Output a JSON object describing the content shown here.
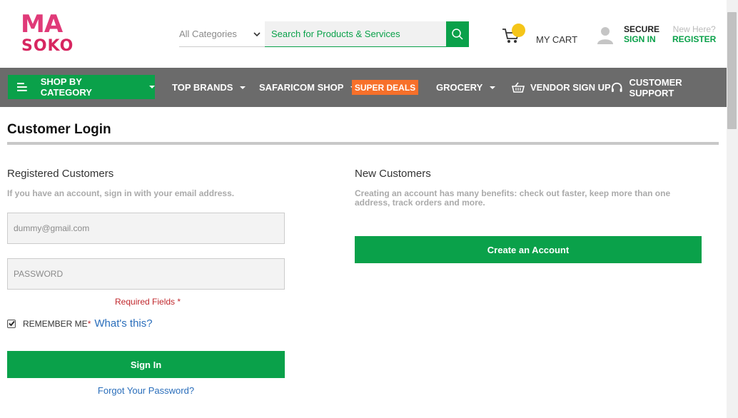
{
  "brand": {
    "logo_top": "MA",
    "logo_bottom": "SOKO"
  },
  "search": {
    "category": "All Categories",
    "placeholder": "Search for Products & Services"
  },
  "header": {
    "cart_label": "MY CART",
    "secure_label": "SECURE",
    "sign_in_label": "SIGN IN",
    "new_here_label": "New Here?",
    "register_label": "REGISTER"
  },
  "nav": {
    "shop_by_category": "SHOP BY CATEGORY",
    "top_brands": "TOP BRANDS",
    "safaricom_shop": "SAFARICOM SHOP",
    "super_deals": "SUPER DEALS",
    "grocery": "GROCERY",
    "vendor_sign_up": "VENDOR SIGN UP",
    "customer_support": "CUSTOMER SUPPORT"
  },
  "page": {
    "title": "Customer Login"
  },
  "registered": {
    "title": "Registered Customers",
    "subtitle": "If you have an account, sign in with your email address.",
    "email_placeholder": "dummy@gmail.com",
    "password_placeholder": "PASSWORD",
    "required_label": "Required Fields",
    "required_star": "*",
    "remember_label": "REMEMBER ME",
    "remember_star": "*",
    "remember_checked": true,
    "whats_this": "What's this?",
    "sign_in_button": "Sign In",
    "forgot_link": "Forgot Your Password?"
  },
  "new_customers": {
    "title": "New Customers",
    "description": "Creating an account has many benefits: check out faster, keep more than one address, track orders and more.",
    "create_button": "Create an Account"
  },
  "colors": {
    "brand_green": "#0aa14a",
    "nav_gray": "#6b6b6b",
    "deals_orange": "#f7702a",
    "link_blue": "#2a6ebb",
    "required_red": "#c0282d",
    "badge_yellow": "#f5c518"
  },
  "icons": [
    "hamburger-icon",
    "chevron-down-icon",
    "search-icon",
    "cart-icon",
    "user-icon",
    "basket-icon",
    "headset-icon",
    "checkmark-icon"
  ]
}
